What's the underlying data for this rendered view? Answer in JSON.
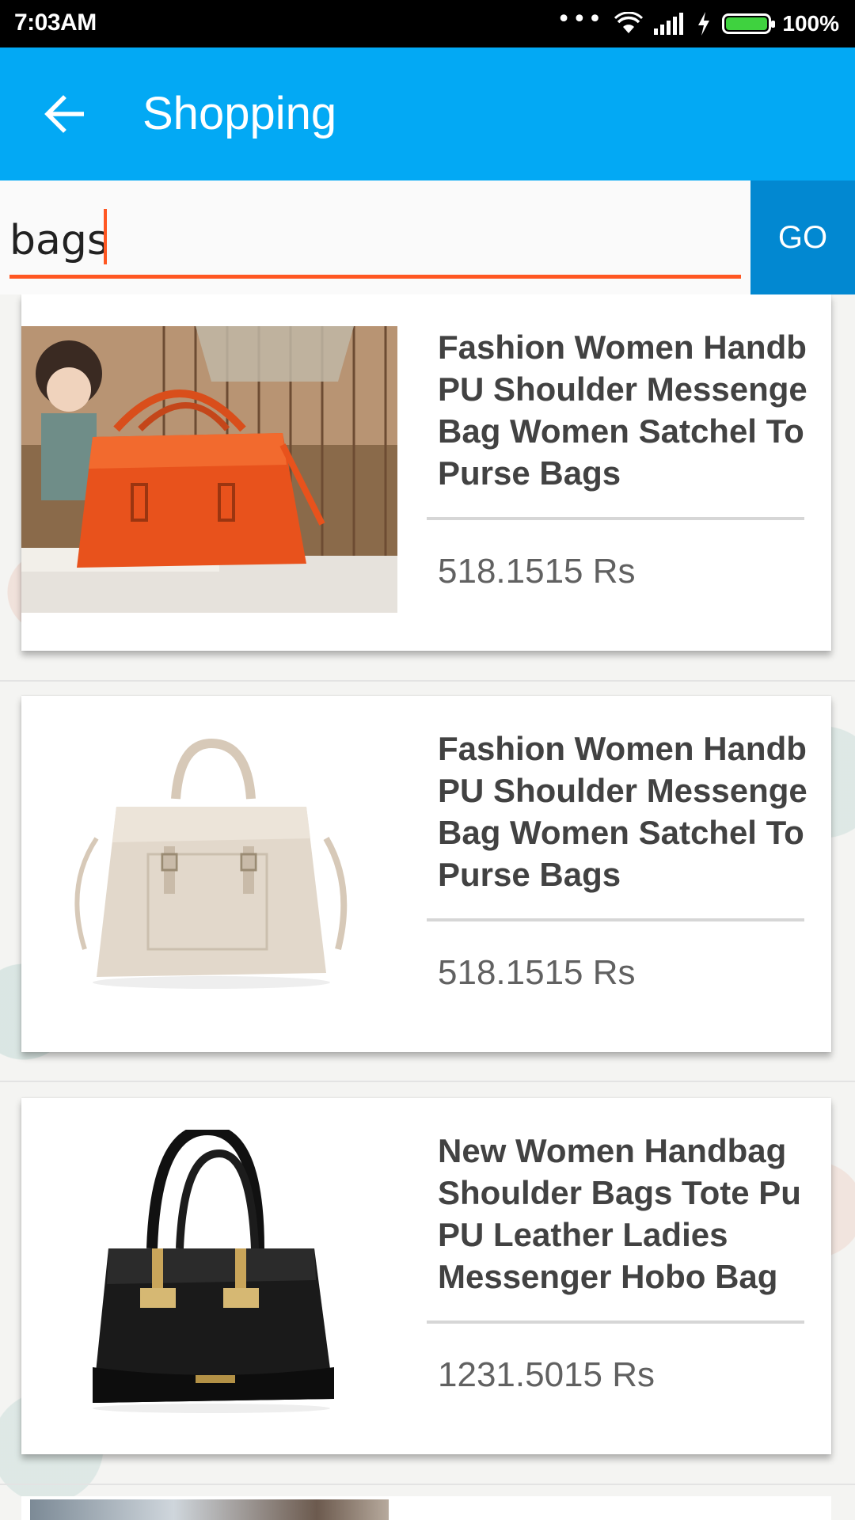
{
  "status_bar": {
    "time": "7:03AM",
    "dots": "•••",
    "battery": "100%",
    "icons": [
      "wifi-icon",
      "signal-icon",
      "charging-icon",
      "battery-icon"
    ]
  },
  "app_bar": {
    "title": "Shopping",
    "back_icon": "arrow-left-icon",
    "color": "#03a9f4"
  },
  "search": {
    "value": "bags",
    "go_label": "GO",
    "accent_color": "#ff5722",
    "go_color": "#0288d1"
  },
  "products": [
    {
      "title": "Fashion Women Handb\nPU Shoulder Messenge\nBag Women Satchel To\nPurse Bags",
      "price": "518.1515 Rs",
      "image": "orange-handbag-image"
    },
    {
      "title": "Fashion Women Handb\nPU Shoulder Messenge\nBag Women Satchel To\nPurse Bags",
      "price": "518.1515 Rs",
      "image": "beige-handbag-image"
    },
    {
      "title": "New Women Handbag\nShoulder Bags Tote Pu\nPU Leather Ladies\nMessenger Hobo Bag",
      "price": "1231.5015 Rs",
      "image": "black-handbag-image"
    }
  ]
}
